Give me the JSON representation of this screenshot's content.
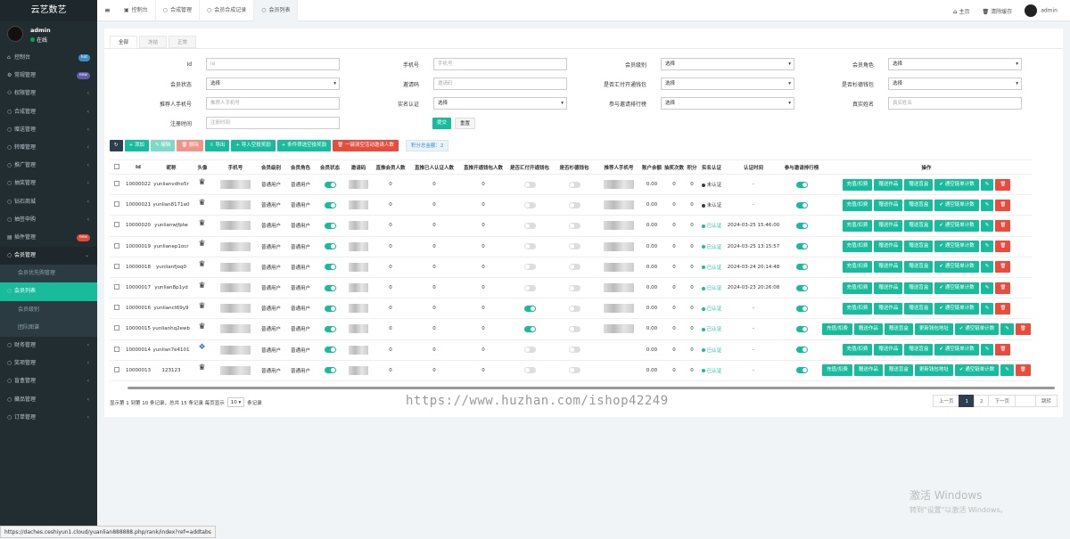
{
  "sidebar": {
    "logo": "云艺数艺",
    "user_name": "admin",
    "user_status": "在线",
    "items": [
      {
        "label": "控制台",
        "icon": "⌂",
        "badge": "hot",
        "badge_color": "#3c8dbc"
      },
      {
        "label": "常规管理",
        "icon": "⚙",
        "badge": "new",
        "badge_color": "#605ca8"
      },
      {
        "label": "权限管理",
        "icon": "⚇",
        "arrow": "‹"
      },
      {
        "label": "合成管理",
        "icon": "○",
        "arrow": "‹"
      },
      {
        "label": "赠送管理",
        "icon": "○",
        "arrow": "‹"
      },
      {
        "label": "转赠管理",
        "icon": "○",
        "arrow": "‹"
      },
      {
        "label": "推广管理",
        "icon": "○",
        "arrow": "‹"
      },
      {
        "label": "抽奖管理",
        "icon": "○",
        "arrow": "‹"
      },
      {
        "label": "钻石商城",
        "icon": "○",
        "arrow": "‹"
      },
      {
        "label": "抽签申购",
        "icon": "○",
        "arrow": "‹"
      },
      {
        "label": "插件管理",
        "icon": "▤",
        "badge": "new",
        "badge_color": "#dd4b39"
      },
      {
        "label": "会员管理",
        "icon": "○",
        "arrow": "⌄",
        "open": true
      },
      {
        "label": "会员优先购管理",
        "sub": true
      },
      {
        "label": "会员列表",
        "icon": "○",
        "active": true
      },
      {
        "label": "会员级别",
        "sub": true
      },
      {
        "label": "团队图谱",
        "sub": true
      },
      {
        "label": "财务管理",
        "icon": "○",
        "arrow": "‹"
      },
      {
        "label": "奖项管理",
        "icon": "○",
        "arrow": "‹"
      },
      {
        "label": "盲盒管理",
        "icon": "○",
        "arrow": "‹"
      },
      {
        "label": "藏品管理",
        "icon": "○",
        "arrow": "‹"
      },
      {
        "label": "订单管理",
        "icon": "○",
        "arrow": "‹"
      }
    ]
  },
  "topbar": {
    "tabs": [
      {
        "label": "控制台",
        "icon": "▣"
      },
      {
        "label": "合成管理",
        "icon": "○"
      },
      {
        "label": "会员合成记录",
        "icon": "○"
      },
      {
        "label": "会员列表",
        "icon": "○"
      }
    ],
    "home": "主页",
    "clear_cache": "清除缓存",
    "admin": "admin"
  },
  "panel_tabs": [
    "全部",
    "冻结",
    "正常"
  ],
  "filters": [
    {
      "label": "Id",
      "placeholder": "Id"
    },
    {
      "label": "手机号",
      "placeholder": "手机号"
    },
    {
      "label": "会员级别",
      "value": "选择",
      "select": true
    },
    {
      "label": "会员角色",
      "value": "选择",
      "select": true
    },
    {
      "label": "会员状态",
      "value": "选择",
      "select": true
    },
    {
      "label": "邀请码",
      "placeholder": "邀请码"
    },
    {
      "label": "是否汇付开通钱包",
      "value": "选择",
      "select": true
    },
    {
      "label": "是否杉德钱包",
      "value": "选择",
      "select": true
    },
    {
      "label": "推荐人手机号",
      "placeholder": "推荐人手机号"
    },
    {
      "label": "实名认证",
      "value": "选择",
      "select": true
    },
    {
      "label": "参与邀请排行榜",
      "value": "选择",
      "select": true
    },
    {
      "label": "真实姓名",
      "placeholder": "真实姓名"
    },
    {
      "label": "注册时间",
      "placeholder": "注册时间"
    }
  ],
  "form_buttons": {
    "submit": "提交",
    "reset": "重置"
  },
  "toolbar": {
    "refresh": "↻",
    "add": "+ 添加",
    "edit": "✎ 编辑",
    "delete": "🗑 删除",
    "export": "⇩ 导出",
    "import_reward": "+ 导入空投奖励",
    "filter_reward": "+ 条件筛选空投奖励",
    "clear_invite": "🗑 一键清空活动邀请人数",
    "stat": "积分总金额：2"
  },
  "table": {
    "headers": [
      "",
      "Id",
      "昵称",
      "头像",
      "手机号",
      "会员级别",
      "会员角色",
      "会员状态",
      "邀请码",
      "直推会员人数",
      "直推已人认证人数",
      "直推开通钱包人数",
      "是否汇付开通钱包",
      "是否杉德钱包",
      "推荐人手机号",
      "账户余额",
      "抽奖次数",
      "积分",
      "实名认证",
      "认证时间",
      "参与邀请排行榜",
      "操作"
    ],
    "rows": [
      {
        "id": "10000022",
        "nick": "yunlianvdho5r",
        "level": "普通用户",
        "role": "普通用户",
        "invite_count": "0",
        "verified_count": "0",
        "wallet_count": "0",
        "huifu": false,
        "sand": false,
        "ref": true,
        "balance": "0.00",
        "draws": "0",
        "points": "0",
        "real": "未认证",
        "real_ok": false,
        "time": "-",
        "rank": true,
        "ops": [
          "充值/扣费",
          "赠送作品",
          "赠送盲盒",
          "✔ 通空链单计数"
        ]
      },
      {
        "id": "10000021",
        "nick": "yunlian8171a0",
        "level": "普通用户",
        "role": "普通用户",
        "invite_count": "0",
        "verified_count": "0",
        "wallet_count": "0",
        "huifu": false,
        "sand": false,
        "ref": true,
        "balance": "0.00",
        "draws": "0",
        "points": "0",
        "real": "未认证",
        "real_ok": false,
        "time": "-",
        "rank": true,
        "ops": [
          "充值/扣费",
          "赠送作品",
          "赠送盲盒",
          "✔ 通空链单计数"
        ]
      },
      {
        "id": "10000020",
        "nick": "yunlianwjfplw",
        "level": "普通用户",
        "role": "普通用户",
        "invite_count": "0",
        "verified_count": "0",
        "wallet_count": "0",
        "huifu": false,
        "sand": false,
        "ref": true,
        "balance": "0.00",
        "draws": "0",
        "points": "0",
        "real": "已认证",
        "real_ok": true,
        "time": "2024-03-25 15:46:00",
        "rank": true,
        "ops": [
          "充值/扣费",
          "赠送作品",
          "赠送盲盒",
          "✔ 通空链单计数"
        ]
      },
      {
        "id": "10000019",
        "nick": "yunlianep1ocr",
        "level": "普通用户",
        "role": "普通用户",
        "invite_count": "0",
        "verified_count": "0",
        "wallet_count": "0",
        "huifu": false,
        "sand": false,
        "ref": true,
        "balance": "0.00",
        "draws": "0",
        "points": "0",
        "real": "已认证",
        "real_ok": true,
        "time": "2024-03-25 13:15:57",
        "rank": true,
        "ops": [
          "充值/扣费",
          "赠送作品",
          "赠送盲盒",
          "✔ 通空链单计数"
        ]
      },
      {
        "id": "10000018",
        "nick": "yunlianfjoq0",
        "level": "普通用户",
        "role": "普通用户",
        "invite_count": "0",
        "verified_count": "0",
        "wallet_count": "0",
        "huifu": false,
        "sand": false,
        "ref": true,
        "balance": "0.00",
        "draws": "0",
        "points": "0",
        "real": "已认证",
        "real_ok": true,
        "time": "2024-03-24 20:14:48",
        "rank": true,
        "ops": [
          "充值/扣费",
          "赠送作品",
          "赠送盲盒",
          "✔ 通空链单计数"
        ]
      },
      {
        "id": "10000017",
        "nick": "yunlian8p1yd",
        "level": "普通用户",
        "role": "普通用户",
        "invite_count": "0",
        "verified_count": "0",
        "wallet_count": "0",
        "huifu": false,
        "sand": false,
        "ref": true,
        "balance": "0.00",
        "draws": "0",
        "points": "0",
        "real": "已认证",
        "real_ok": true,
        "time": "2024-03-23 20:26:08",
        "rank": true,
        "ops": [
          "充值/扣费",
          "赠送作品",
          "赠送盲盒",
          "✔ 通空链单计数"
        ]
      },
      {
        "id": "10000016",
        "nick": "yunlianct69y9",
        "level": "普通用户",
        "role": "普通用户",
        "invite_count": "0",
        "verified_count": "0",
        "wallet_count": "0",
        "huifu": true,
        "sand": false,
        "ref": true,
        "balance": "0.00",
        "draws": "0",
        "points": "0",
        "real": "已认证",
        "real_ok": true,
        "time": "-",
        "rank": true,
        "ops": [
          "充值/扣费",
          "赠送作品",
          "赠送盲盒",
          "✔ 通空链单计数"
        ]
      },
      {
        "id": "10000015",
        "nick": "yunlianhq2ewb",
        "level": "普通用户",
        "role": "普通用户",
        "invite_count": "0",
        "verified_count": "0",
        "wallet_count": "0",
        "huifu": true,
        "sand": false,
        "ref": true,
        "balance": "0.00",
        "draws": "0",
        "points": "0",
        "real": "已认证",
        "real_ok": true,
        "time": "-",
        "rank": true,
        "ops": [
          "充值/扣费",
          "赠送作品",
          "赠送盲盒",
          "更新钱包地址",
          "✔ 通空链单计数"
        ]
      },
      {
        "id": "10000014",
        "nick": "yunlian7e4101",
        "level": "普通用户",
        "role": "普通用户",
        "invite_count": "0",
        "verified_count": "0",
        "wallet_count": "0",
        "huifu": false,
        "sand": false,
        "ref": false,
        "balance": "0.00",
        "draws": "0",
        "points": "0",
        "real": "已认证",
        "real_ok": true,
        "time": "-",
        "rank": true,
        "blue": true,
        "ops": [
          "充值/扣费",
          "赠送作品",
          "赠送盲盒",
          "✔ 通空链单计数"
        ]
      },
      {
        "id": "10000013",
        "nick": "123123",
        "level": "普通用户",
        "role": "普通用户",
        "invite_count": "0",
        "verified_count": "0",
        "wallet_count": "0",
        "huifu": false,
        "sand": false,
        "ref": false,
        "balance": "0.00",
        "draws": "0",
        "points": "0",
        "real": "已认证",
        "real_ok": true,
        "time": "-",
        "rank": true,
        "ops": [
          "充值/扣费",
          "赠送作品",
          "赠送盲盒",
          "更新钱包地址",
          "✔ 通空链单计数"
        ]
      }
    ]
  },
  "pagination": {
    "info": "显示第 1 到第 10 条记录，总共 15 条记录 每页显示",
    "page_size": "10 ▾",
    "info_suffix": "条记录",
    "prev": "上一页",
    "p1": "1",
    "p2": "2",
    "next": "下一页",
    "go": "跳转"
  },
  "watermark": "https://www.huzhan.com/ishop42249",
  "windows": {
    "line1": "激活 Windows",
    "line2": "转到\"设置\"以激活 Windows。"
  },
  "statusbar": "https://daches.ceshiyun1.cloud/yuanlian888888.php/rank/index?ref=addtabs",
  "colors": {
    "accent": "#18bc9c",
    "sidebar": "#222d32",
    "danger": "#e74c3c"
  }
}
